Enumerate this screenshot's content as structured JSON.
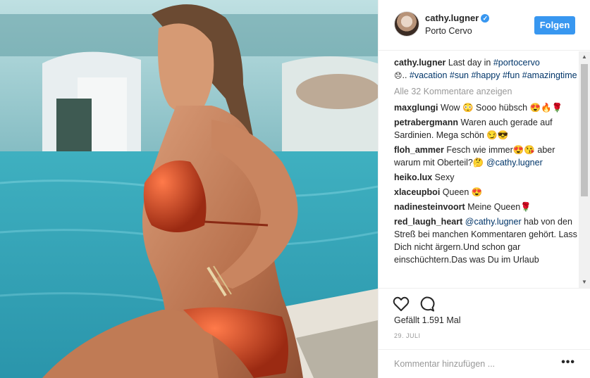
{
  "post": {
    "username": "cathy.lugner",
    "location": "Porto Cervo",
    "follow_label": "Folgen",
    "caption": {
      "username": "cathy.lugner",
      "text_1": "Last day in",
      "tag_1": "#portocervo",
      "emoji_1": "😞",
      "text_2": "..",
      "tags": "#vacation #sun #happy #fun #amazingtime"
    },
    "view_all_comments": "Alle 32 Kommentare anzeigen",
    "comments": [
      {
        "user": "maxglungi",
        "text": "Wow 😳 Sooo hübsch 😍🔥🌹"
      },
      {
        "user": "petrabergmann",
        "text": "Waren auch gerade auf Sardinien. Mega schön 😏😎"
      },
      {
        "user": "floh_ammer",
        "text": "Fesch wie immer😍😘 aber warum mit Oberteil?🤔",
        "mention": "@cathy.lugner"
      },
      {
        "user": "heiko.lux",
        "text": "Sexy"
      },
      {
        "user": "xlaceupboi",
        "text": "Queen 😍"
      },
      {
        "user": "nadinesteinvoort",
        "text": "Meine Queen🌹"
      },
      {
        "user": "red_laugh_heart",
        "mention": "@cathy.lugner",
        "text": "hab von den Streß bei manchen Kommentaren gehört. Lass Dich nicht ärgern.Und schon gar einschüchtern.Das was Du im Urlaub"
      }
    ],
    "likes": "Gefällt 1.591 Mal",
    "date": "29. JULI",
    "add_comment_placeholder": "Kommentar hinzufügen ...",
    "more_label": "•••"
  },
  "icons": {
    "like": "heart-outline-icon",
    "comment": "speech-bubble-icon",
    "verified": "verified-badge-icon",
    "more": "more-dots-icon"
  },
  "colors": {
    "accent": "#3897f0",
    "hashtag": "#003569",
    "muted": "#999999"
  }
}
